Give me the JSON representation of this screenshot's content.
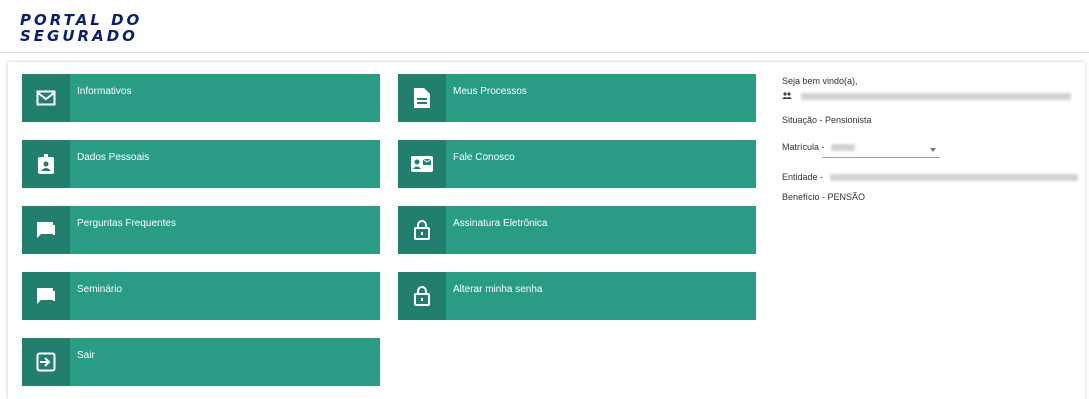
{
  "header": {
    "logo_line1": "PORTAL DO",
    "logo_line2": "SEGURADO"
  },
  "menu": {
    "tiles": [
      {
        "label": "Informativos",
        "icon": "mail-icon"
      },
      {
        "label": "Meus Processos",
        "icon": "document-icon"
      },
      {
        "label": "Dados Pessoais",
        "icon": "id-badge-icon"
      },
      {
        "label": "Fale Conosco",
        "icon": "contact-card-icon"
      },
      {
        "label": "Perguntas Frequentes",
        "icon": "chat-icon"
      },
      {
        "label": "Assinatura Eletrônica",
        "icon": "lock-icon"
      },
      {
        "label": "Seminário",
        "icon": "chat-icon"
      },
      {
        "label": "Alterar minha senha",
        "icon": "lock-icon"
      },
      {
        "label": "Sair",
        "icon": "exit-icon"
      }
    ]
  },
  "user_info": {
    "welcome": "Seja bem vindo(a),",
    "situacao": "Situação - Pensionista",
    "matricula_label": "Matrícula -",
    "entidade_label": "Entidade -",
    "beneficio": "Benefício - PENSÃO"
  },
  "colors": {
    "tile": "#2a9c86",
    "tile_icon_bg": "#227f6d",
    "logo": "#0b1f6e"
  }
}
